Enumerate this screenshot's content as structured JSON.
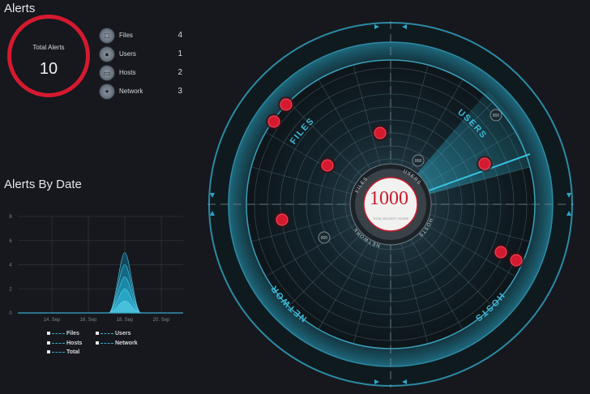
{
  "alerts": {
    "title": "Alerts",
    "total_label": "Total Alerts",
    "total_value": "10",
    "categories": [
      {
        "label": "Files",
        "count": "4",
        "icon": "file-icon"
      },
      {
        "label": "Users",
        "count": "1",
        "icon": "user-icon"
      },
      {
        "label": "Hosts",
        "count": "2",
        "icon": "host-icon"
      },
      {
        "label": "Network",
        "count": "3",
        "icon": "network-icon"
      }
    ]
  },
  "alerts_by_date": {
    "title": "Alerts By Date",
    "legend": {
      "files": "Files",
      "users": "Users",
      "hosts": "Hosts",
      "network": "Network",
      "total": "Total"
    }
  },
  "chart_data": {
    "type": "area",
    "title": "Alerts By Date",
    "x_tick_labels": [
      "14. Sep",
      "16. Sep",
      "18. Sep",
      "20. Sep"
    ],
    "y_ticks": [
      0,
      2,
      4,
      6,
      8
    ],
    "ylim": [
      0,
      8
    ],
    "grid": true,
    "series": [
      {
        "name": "Total",
        "peak_date": "18. Sep",
        "peak_value": 5
      },
      {
        "name": "Files",
        "peak_date": "18. Sep",
        "peak_value": 4
      },
      {
        "name": "Network",
        "peak_date": "18. Sep",
        "peak_value": 3
      },
      {
        "name": "Hosts",
        "peak_date": "18. Sep",
        "peak_value": 2
      },
      {
        "name": "Users",
        "peak_date": "18. Sep",
        "peak_value": 1
      }
    ],
    "legend_position": "bottom"
  },
  "radar": {
    "score": "1000",
    "score_caption": "TOTAL SECURITY SCORE",
    "inner_labels": {
      "files": "FILES",
      "users": "USERS",
      "hosts": "HOSTS",
      "network": "NETWORK"
    },
    "quadrant_labels": {
      "files": "FILES",
      "users": "USERS",
      "hosts": "HOSTS",
      "network": "NETWORK"
    },
    "markers": [
      "800",
      "868",
      "800"
    ],
    "colors": {
      "alert": "#d5192f",
      "ring": "#2f8fa8",
      "accent": "#33b7d6"
    }
  }
}
